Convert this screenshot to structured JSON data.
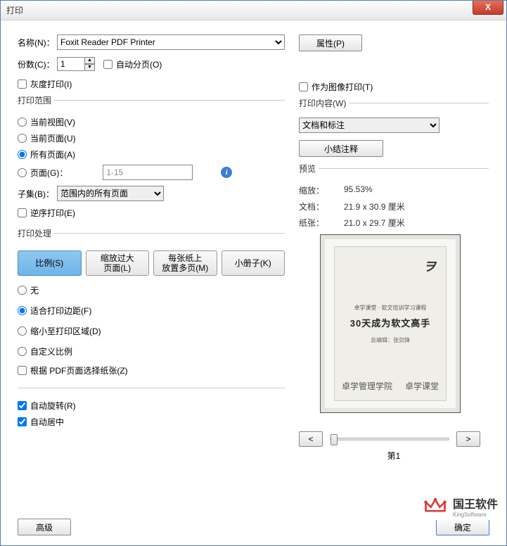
{
  "window": {
    "title": "打印",
    "close": "X"
  },
  "name": {
    "label": "名称(N)：",
    "value": "Foxit Reader PDF Printer",
    "props_btn": "属性(P)"
  },
  "copies": {
    "label": "份数(C)：",
    "value": "1",
    "collate": "自动分页(O)"
  },
  "grayscale": "灰度打印(I)",
  "as_image": "作为图像打印(T)",
  "range": {
    "legend": "打印范围",
    "current_view": "当前视图(V)",
    "current_page": "当前页面(U)",
    "all_pages": "所有页面(A)",
    "pages": "页面(G)：",
    "pages_value": "1-15",
    "subset_label": "子集(B)：",
    "subset_value": "范围内的所有页面",
    "reverse": "逆序打印(E)"
  },
  "handling": {
    "legend": "打印处理",
    "tab_scale": "比例(S)",
    "tab_fit": "缩放过大\n页面(L)",
    "tab_multi": "每张纸上\n放置多页(M)",
    "tab_booklet": "小册子(K)",
    "none": "无",
    "fit_margin": "适合打印边距(F)",
    "shrink": "缩小至打印区域(D)",
    "custom": "自定义比例",
    "by_pdf_page": "根据 PDF页面选择纸张(Z)"
  },
  "auto_rotate": "自动旋转(R)",
  "auto_center": "自动居中",
  "adv_btn": "高级",
  "content": {
    "legend": "打印内容(W)",
    "value": "文档和标注",
    "summarize_btn": "小结注释"
  },
  "preview": {
    "legend": "预览",
    "zoom_k": "缩放：",
    "zoom_v": "95.53%",
    "doc_k": "文档：",
    "doc_v": "21.9 x 30.9 厘米",
    "paper_k": "纸张：",
    "paper_v": "21.0 x 29.7 厘米",
    "page_indicator": "第1",
    "book_sub": "卓学课堂 · 软文培训学习课程",
    "book_title": "30天成为软文高手",
    "book_author": "总编辑：张剑锋",
    "book_footer_l": "卓学管理学院",
    "book_footer_r": "卓学课堂"
  },
  "ok_btn": "确定",
  "watermark": {
    "text": "国王软件",
    "sub": "KingSoftware"
  }
}
